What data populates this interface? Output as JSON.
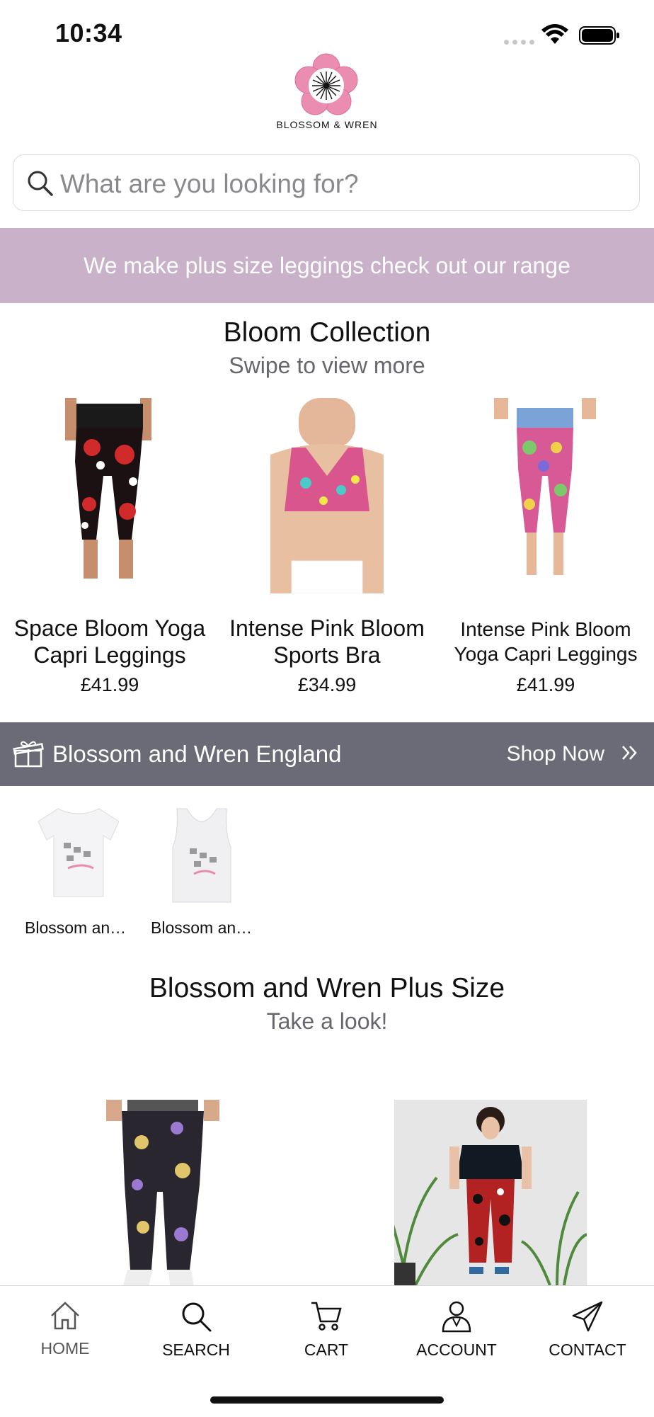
{
  "status_bar": {
    "time": "10:34"
  },
  "brand": {
    "name": "BLOSSOM & WREN",
    "logo_icon": "flower-logo-icon",
    "accent_pink": "#e98aae"
  },
  "search": {
    "placeholder": "What are you looking for?"
  },
  "promo": {
    "text": "We make plus size leggings check out our range",
    "bg": "#c9b2c9"
  },
  "bloom_collection": {
    "title": "Bloom Collection",
    "subtitle": "Swipe to view more",
    "products": [
      {
        "name": "Space Bloom Yoga Capri Leggings",
        "price": "£41.99"
      },
      {
        "name": "Intense Pink Bloom Sports Bra",
        "price": "£34.99"
      },
      {
        "name": "Intense Pink Bloom Yoga Capri Leggings",
        "price": "£41.99"
      }
    ]
  },
  "shop_banner": {
    "title": "Blossom and Wren England",
    "action": "Shop Now",
    "bg": "#6b6a77"
  },
  "england_items": [
    {
      "label": "Blossom an…"
    },
    {
      "label": "Blossom an…"
    }
  ],
  "plus_size": {
    "title": "Blossom and Wren Plus Size",
    "subtitle": "Take a look!"
  },
  "tabbar": {
    "home": "HOME",
    "search": "SEARCH",
    "cart": "CART",
    "account": "ACCOUNT",
    "contact": "CONTACT"
  }
}
